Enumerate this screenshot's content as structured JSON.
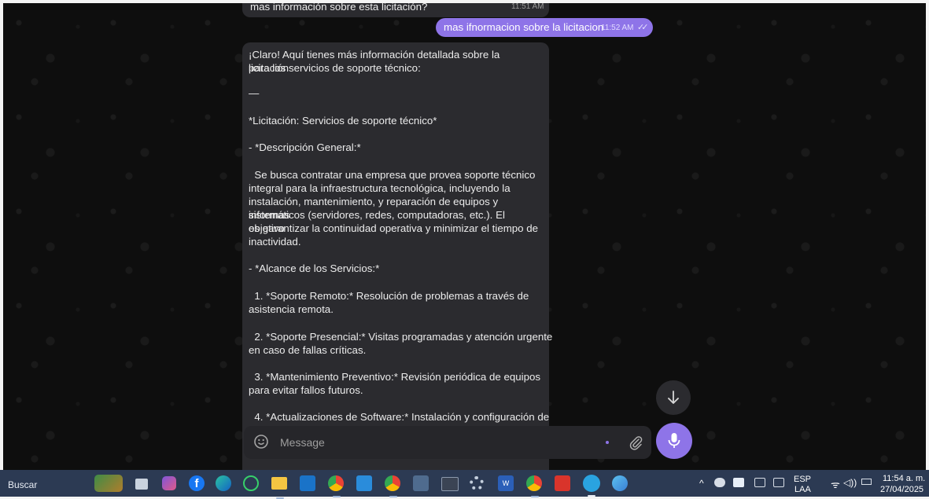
{
  "chat": {
    "previous_message": {
      "text": "mas información sobre esta licitación?",
      "time": "11:51 AM"
    },
    "outgoing_message": {
      "text": "mas ifnormacion sobre la licitacion",
      "time": "11:52 AM",
      "status": "read"
    },
    "incoming_message": {
      "lines": [
        "¡Claro! Aquí tienes más información detallada sobre la licitación",
        "para los servicios de soporte técnico:",
        "—",
        "*Licitación: Servicios de soporte técnico*",
        "- *Descripción General:*",
        "  Se busca contratar una empresa que provea soporte técnico",
        "integral para la infraestructura tecnológica, incluyendo la",
        "instalación, mantenimiento, y reparación de equipos y sistemas",
        "informáticos (servidores, redes, computadoras, etc.). El objetivo",
        "es garantizar la continuidad operativa y minimizar el tiempo de",
        "inactividad.",
        "- *Alcance de los Servicios:*",
        "  1. *Soporte Remoto:* Resolución de problemas a través de",
        "asistencia remota.",
        "  2. *Soporte Presencial:* Visitas programadas y atención urgente",
        "en caso de fallas críticas.",
        "  3. *Mantenimiento Preventivo:* Revisión periódica de equipos",
        "para evitar fallos futuros.",
        "  4. *Actualizaciones de Software:* Instalación y configuración de"
      ]
    },
    "composer": {
      "placeholder": "Message",
      "emoji_icon": "smiley-icon",
      "attach_icon": "paperclip-icon",
      "mic_icon": "microphone-icon"
    },
    "scroll_down_icon": "arrow-down-icon",
    "accent_color": "#8e74e8"
  },
  "taskbar": {
    "search_label": "Buscar",
    "apps": [
      "widgets-icon",
      "task-view-icon",
      "app-icon",
      "facebook-icon",
      "edge-icon",
      "whatsapp-icon",
      "file-explorer-icon",
      "outlook-icon",
      "chrome-icon",
      "vscode-icon",
      "chrome-profile-icon",
      "app-icon",
      "terminal-icon",
      "settings-icon",
      "word-icon",
      "chrome-profile-icon",
      "acrobat-icon",
      "telegram-icon",
      "app-icon"
    ],
    "tray": {
      "language_top": "ESP",
      "language_bottom": "LAA",
      "time": "11:54 a. m.",
      "date": "27/04/2025"
    }
  }
}
